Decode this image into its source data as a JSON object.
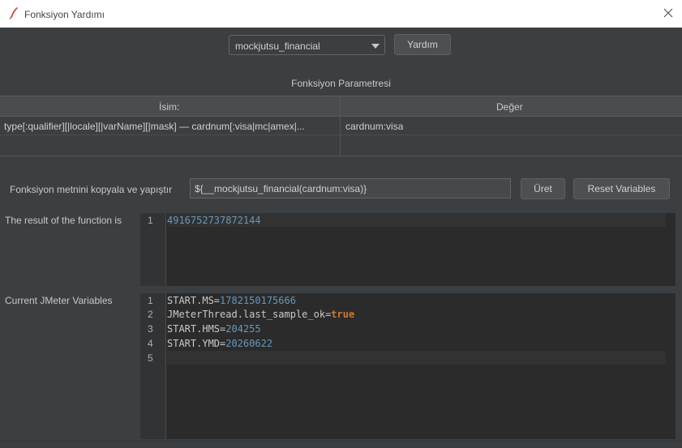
{
  "window": {
    "title": "Fonksiyon Yardımı"
  },
  "function_selector": {
    "selected": "mockjutsu_financial"
  },
  "buttons": {
    "help": "Yardım",
    "generate": "Üret",
    "reset": "Reset Variables"
  },
  "params": {
    "section_title": "Fonksiyon Parametresi",
    "columns": [
      "İsim:",
      "Değer"
    ],
    "rows": [
      {
        "name": "type[:qualifier][|locale][|varName][|mask]  —  cardnum[:visa|mc|amex|...",
        "value": "cardnum:visa"
      }
    ]
  },
  "function_text": {
    "label": "Fonksiyon metnini kopyala ve yapıştır",
    "value": "${__mockjutsu_financial(cardnum:visa)}"
  },
  "result": {
    "label": "The result of the function is",
    "lines": [
      {
        "no": "1",
        "value": "4916752737872144"
      }
    ]
  },
  "variables": {
    "label": "Current JMeter Variables",
    "lines": [
      {
        "no": "1",
        "key": "START.MS=",
        "value": "1782150175666"
      },
      {
        "no": "2",
        "key": "JMeterThread.last_sample_ok=",
        "value": "true"
      },
      {
        "no": "3",
        "key": "START.HMS=",
        "value": "204255"
      },
      {
        "no": "4",
        "key": "START.YMD=",
        "value": "20260622"
      },
      {
        "no": "5",
        "key": "",
        "value": ""
      }
    ]
  },
  "icons": {
    "app": "feather-pen-icon",
    "close": "close-icon",
    "dropdown": "chevron-down-icon"
  },
  "colors": {
    "background": "#3c3f41",
    "editor": "#2b2b2b",
    "number": "#6897bb",
    "keyword": "#cc7832"
  }
}
